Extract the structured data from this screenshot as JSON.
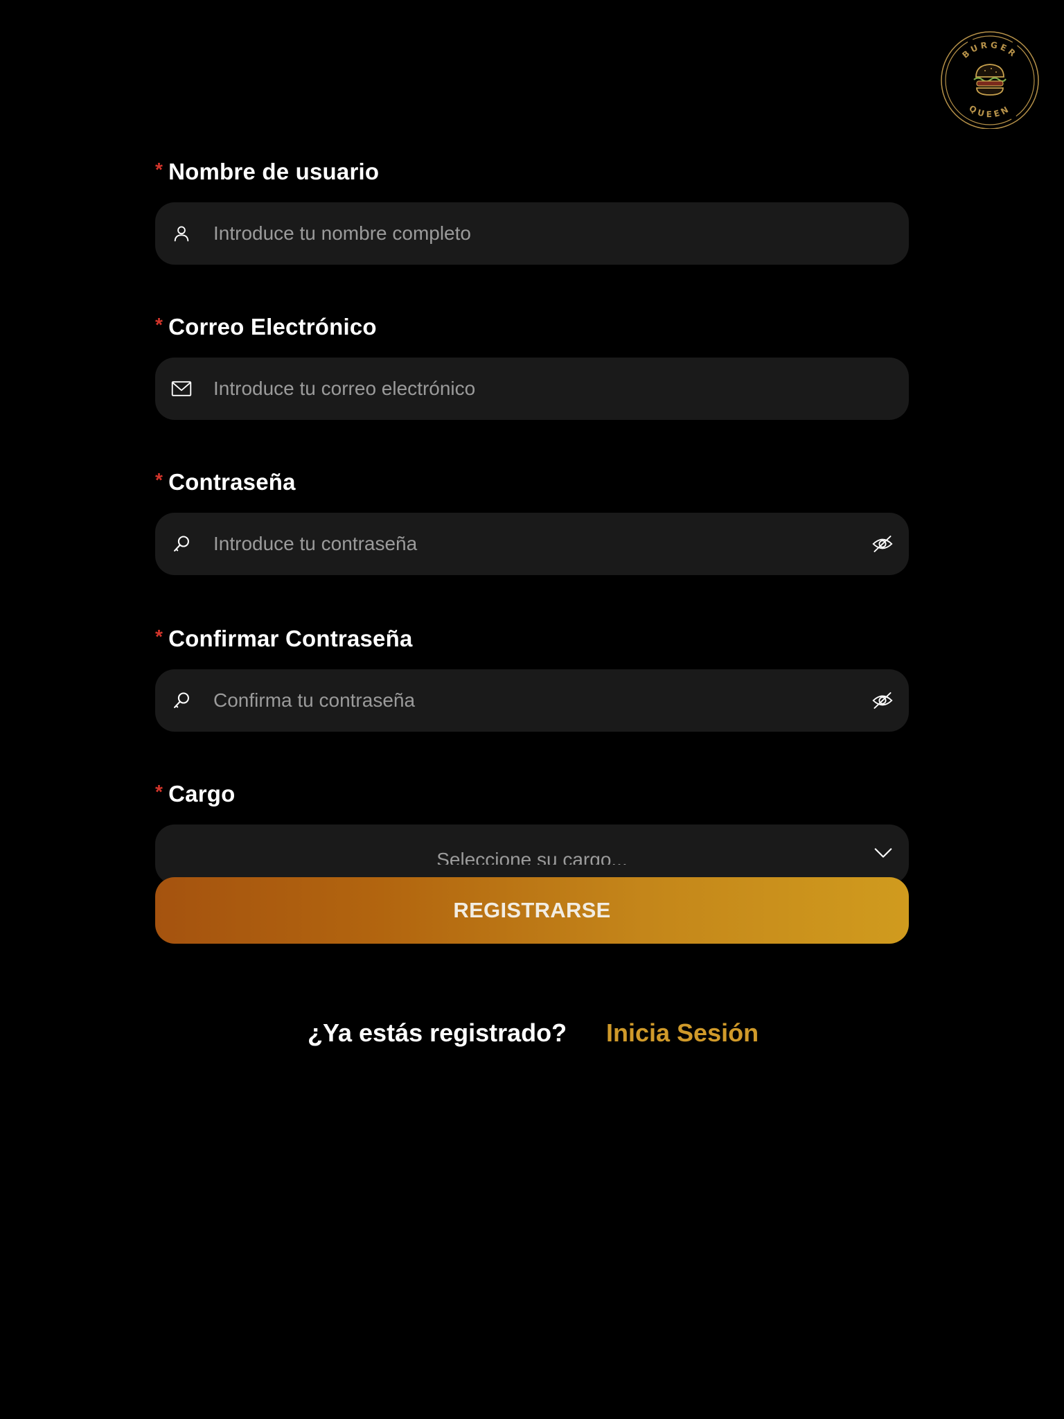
{
  "brand": {
    "logo_top_text": "BURGER",
    "logo_bottom_text": "QUEEN",
    "logo_color": "#b8934a"
  },
  "form": {
    "required_mark": "*",
    "fields": [
      {
        "label": "Nombre de usuario",
        "placeholder": "Introduce tu nombre completo",
        "icon": "user-icon"
      },
      {
        "label": "Correo Electrónico",
        "placeholder": "Introduce tu correo electrónico",
        "icon": "mail-icon"
      },
      {
        "label": "Contraseña",
        "placeholder": "Introduce tu contraseña",
        "icon": "key-icon",
        "trailing_icon": "eye-off-icon"
      },
      {
        "label": "Confirmar Contraseña",
        "placeholder": "Confirma tu contraseña",
        "icon": "key-icon",
        "trailing_icon": "eye-off-icon"
      }
    ],
    "role": {
      "label": "Cargo",
      "placeholder": "Seleccione su cargo...",
      "icon": "chevron-down-icon"
    },
    "submit_label": "REGISTRARSE"
  },
  "footer": {
    "question": "¿Ya estás registrado?",
    "login_link": "Inicia Sesión"
  },
  "colors": {
    "background": "#000000",
    "input_bg": "#1a1a1a",
    "required": "#d2352b",
    "accent_link": "#d09a2a",
    "button_gradient_start": "#a5530f",
    "button_gradient_end": "#d09b1e"
  }
}
